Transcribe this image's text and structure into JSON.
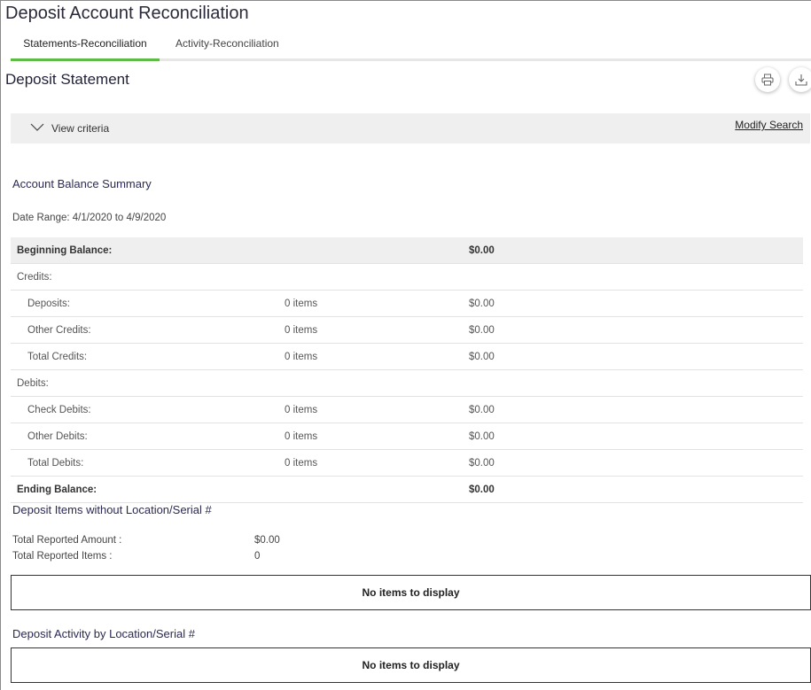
{
  "page": {
    "title": "Deposit Account Reconciliation"
  },
  "tabs": [
    {
      "label": "Statements-Reconciliation",
      "active": true
    },
    {
      "label": "Activity-Reconciliation",
      "active": false
    }
  ],
  "section": {
    "title": "Deposit Statement"
  },
  "toolbar": {
    "print_icon": "print-icon",
    "download_icon": "download-icon"
  },
  "criteria": {
    "label": "View criteria",
    "modify_label": "Modify Search"
  },
  "summary": {
    "title": "Account Balance Summary",
    "date_range": "Date Range: 4/1/2020 to 4/9/2020",
    "rows": [
      {
        "label": "Beginning Balance:",
        "items": "",
        "amount": "$0.00",
        "style": "head"
      },
      {
        "label": "Credits:",
        "items": "",
        "amount": "",
        "style": "group"
      },
      {
        "label": "Deposits:",
        "items": "0 items",
        "amount": "$0.00",
        "style": "indent"
      },
      {
        "label": "Other Credits:",
        "items": "0 items",
        "amount": "$0.00",
        "style": "indent"
      },
      {
        "label": "Total Credits:",
        "items": "0 items",
        "amount": "$0.00",
        "style": "indent"
      },
      {
        "label": "Debits:",
        "items": "",
        "amount": "",
        "style": "group"
      },
      {
        "label": "Check Debits:",
        "items": "0 items",
        "amount": "$0.00",
        "style": "indent"
      },
      {
        "label": "Other Debits:",
        "items": "0 items",
        "amount": "$0.00",
        "style": "indent"
      },
      {
        "label": "Total Debits:",
        "items": "0 items",
        "amount": "$0.00",
        "style": "indent"
      },
      {
        "label": "Ending Balance:",
        "items": "",
        "amount": "$0.00",
        "style": "bold"
      }
    ]
  },
  "deposit_items": {
    "title": "Deposit Items without Location/Serial #",
    "total_amount_label": "Total Reported Amount :",
    "total_amount_value": "$0.00",
    "total_items_label": "Total Reported Items :",
    "total_items_value": "0",
    "empty_text": "No items to display"
  },
  "deposit_activity": {
    "title": "Deposit Activity by Location/Serial #",
    "empty_text": "No items to display"
  },
  "colors": {
    "accent": "#5dbb46",
    "heading": "#2b2a55",
    "band": "#efefef"
  }
}
